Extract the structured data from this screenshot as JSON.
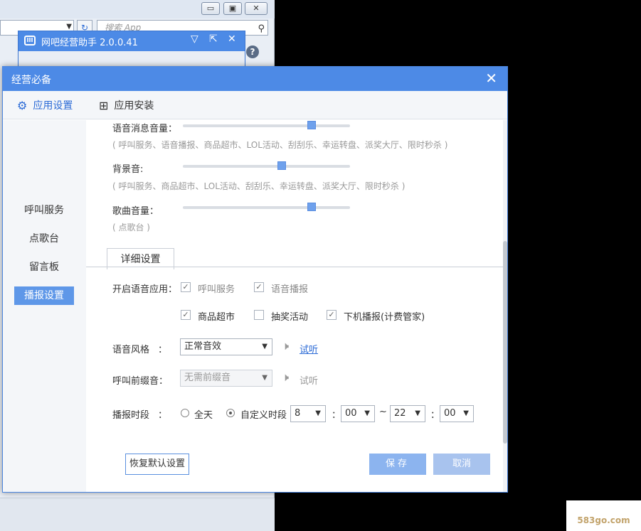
{
  "background_window": {
    "search_placeholder": "搜索 App",
    "help_glyph": "?"
  },
  "mini_window": {
    "logo_glyph": "III",
    "title": "网吧经营助手 2.0.0.41"
  },
  "dialog": {
    "title": "经营必备",
    "close_glyph": "✕"
  },
  "tabs": [
    {
      "label": "应用设置",
      "icon": "gear-icon",
      "active": true
    },
    {
      "label": "应用安装",
      "icon": "grid-icon",
      "active": false
    }
  ],
  "sidebar": {
    "items": [
      {
        "label": "呼叫服务",
        "active": false
      },
      {
        "label": "点歌台",
        "active": false
      },
      {
        "label": "留言板",
        "active": false
      },
      {
        "label": "播报设置",
        "active": true
      }
    ]
  },
  "volume": {
    "voice_message": {
      "label": "语音消息音量：",
      "hint": "( 呼叫服务、语音播报、商品超市、LOL活动、刮刮乐、幸运转盘、派奖大厅、限时秒杀 )",
      "level": 0.77
    },
    "background": {
      "label": "背景音:",
      "hint": "( 呼叫服务、商品超市、LOL活动、刮刮乐、幸运转盘、派奖大厅、限时秒杀 )",
      "level": 0.59
    },
    "song": {
      "label": "歌曲音量：",
      "hint": "( 点歌台 )",
      "level": 0.77
    }
  },
  "detail": {
    "tab_label": "详细设置",
    "enable_voice_label": "开启语音应用：",
    "options": [
      {
        "label": "呼叫服务",
        "checked": true
      },
      {
        "label": "语音播报",
        "checked": true
      },
      {
        "label": "商品超市",
        "checked": true
      },
      {
        "label": "抽奖活动",
        "checked": false
      },
      {
        "label": "下机播报(计费管家)",
        "checked": true
      }
    ],
    "voice_style": {
      "label": "语音风格",
      "colon": "：",
      "value": "正常音效",
      "preview": "试听"
    },
    "call_prefix": {
      "label": "呼叫前缀音：",
      "value": "无需前缀音",
      "preview": "试听"
    },
    "broadcast_time": {
      "label": "播报时段",
      "colon": "：",
      "all_day": "全天",
      "custom": "自定义时段",
      "selected": "custom",
      "start_hour": "8",
      "start_minute": "00",
      "tilde": "~",
      "end_hour": "22",
      "end_minute": "00",
      "sep": "："
    }
  },
  "buttons": {
    "restore": "恢复默认设置",
    "save": "保存",
    "cancel": "取消"
  },
  "watermark": "583go.com",
  "colors": {
    "accent": "#4d8ae6",
    "active_sidebar": "#5e97e8",
    "save_button": "#8cb4ef"
  }
}
